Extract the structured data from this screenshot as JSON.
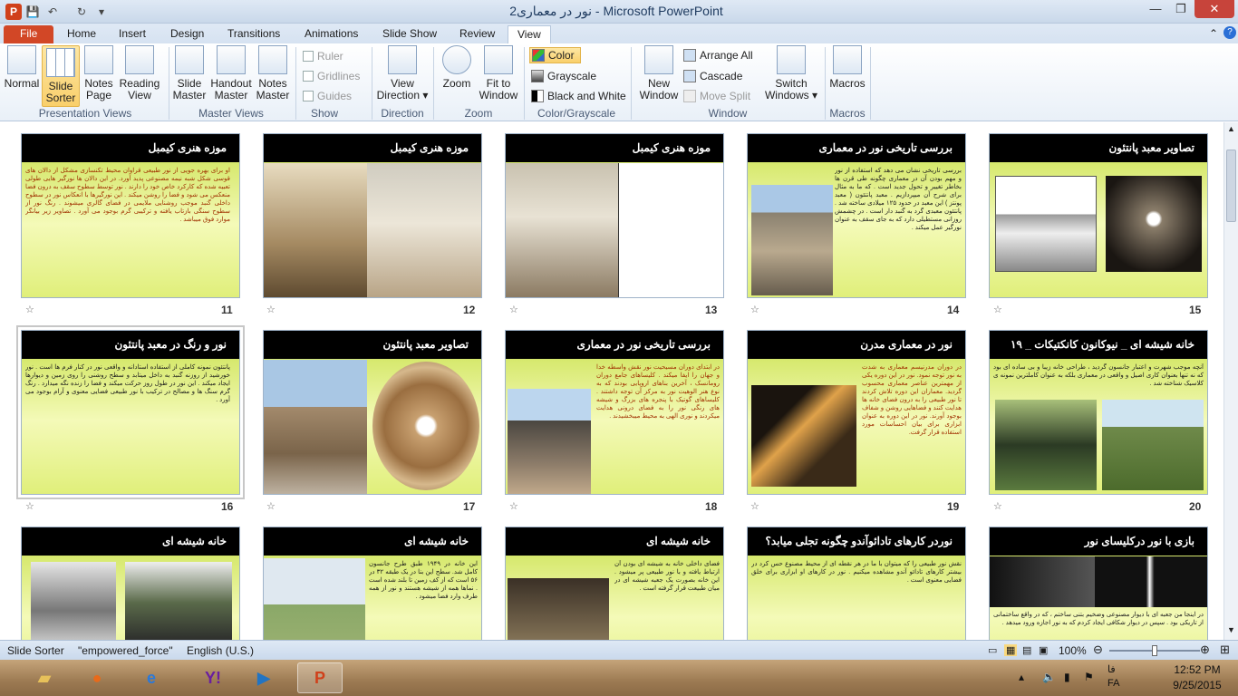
{
  "window": {
    "title": "نور در معماری2 - Microsoft PowerPoint",
    "minimize": "—",
    "maximize": "❐",
    "close": "✕"
  },
  "qat": {
    "save": "💾",
    "undo": "↶",
    "redo": "↻",
    "customize": "▾",
    "logo": "P"
  },
  "tabs": [
    "File",
    "Home",
    "Insert",
    "Design",
    "Transitions",
    "Animations",
    "Slide Show",
    "Review",
    "View"
  ],
  "active_tab": "View",
  "ribbon": {
    "presentation_views": {
      "label": "Presentation Views",
      "normal": "Normal",
      "slide_sorter": "Slide\nSorter",
      "notes_page": "Notes\nPage",
      "reading_view": "Reading\nView"
    },
    "master_views": {
      "label": "Master Views",
      "slide_master": "Slide\nMaster",
      "handout_master": "Handout\nMaster",
      "notes_master": "Notes\nMaster"
    },
    "show": {
      "label": "Show",
      "ruler": "Ruler",
      "gridlines": "Gridlines",
      "guides": "Guides"
    },
    "direction": {
      "label": "Direction",
      "view_direction": "View\nDirection ▾"
    },
    "zoom": {
      "label": "Zoom",
      "zoom": "Zoom",
      "fit_to_window": "Fit to\nWindow"
    },
    "color": {
      "label": "Color/Grayscale",
      "color": "Color",
      "grayscale": "Grayscale",
      "black_white": "Black and White"
    },
    "window": {
      "label": "Window",
      "new_window": "New\nWindow",
      "arrange_all": "Arrange All",
      "cascade": "Cascade",
      "move_split": "Move Split",
      "switch_windows": "Switch\nWindows ▾"
    },
    "macros": {
      "label": "Macros",
      "macros": "Macros"
    }
  },
  "slides_row1": [
    {
      "num": "15",
      "title": "تصاویر معبد پانتئون"
    },
    {
      "num": "14",
      "title": "بررسی تاریخی نور در معماری",
      "text": "بررسی تاریخی نشان می دهد که استفاده از نور و مهم بودن آن در معماری چگونه طی قرن ها بخاطر تغییر و تحول جدید است . که ما به مثال برای شرح آن میپردازیم . معبد پانتئون ( معبد پونتز ) این معبد در حدود ۱۲۵ میلادی ساخته شد . پانتئون معبدی گرد به گنبد دار است . در چشمش روزانی مستطیلی دارد که به جای سقف به عنوان نورگیر عمل میکند ."
    },
    {
      "num": "13",
      "title": "موزه هنری کیمبل"
    },
    {
      "num": "12",
      "title": "موزه هنری کیمبل"
    },
    {
      "num": "11",
      "title": "موزه هنری کیمبل",
      "text": "او برای بهره جویی از نور طبیعی قراوان محیط تکنسازی مشکل از دالان های قوسی شکل شبه نیمه مصنوعی پدید آورد. در این دالان ها نورگیر هایی طولی تعبیه شده که کارکرد خاص خود را دارند . نور توسط سطوح سقف به درون فضا منعکس می شود و فضا را روشن میکند . این نورگیرها با انعکاس نور در سطوح داخلی گنبد موجب روشنایی ملایمی در فضای گالری میشوند . رنگ نور از سطوح سنگی بازتاب یافته و ترکیبی گرم بوجود می آورد . تصاویر زیر بیانگر موارد فوق میباشد ."
    }
  ],
  "slides_row2": [
    {
      "num": "20",
      "title": "خانه شیشه ای _ نیوکانون کانکتیکات _ ۱۹",
      "text": "آنچه موجب شهرت و اعتبار جانسون گردید ، طراحی خانه زیبا و بی ساده ای بود که نه تنها بعنوان کاری اصیل و واقعی در معماری بلکه به عنوان کاملترین نمونه ی کلاسیک شناخته شد ."
    },
    {
      "num": "19",
      "title": "نور در معماری مدرن",
      "text": "در دوران مدرنیسم معماری به شدت به نور توجه نمود. نور در این دوره یکی از مهمترین عناصر معماری محسوب گردید. معماران این دوره تلاش کردند تا نور طبیعی را به درون فضای خانه ها هدایت کنند و فضاهایی روشن و شفاف بوجود آورند. نور در این دوره به عنوان ابزاری برای بیان احساسات مورد استفاده قرار گرفت."
    },
    {
      "num": "18",
      "title": "بررسی تاریخی نور در معماری",
      "text": "در ابتدای دوران مسیحیت نور نقش واسطه خدا و جهان را ایفا میکند . کلیساهای جامع دوران رومانسک ، آخرین بناهای اروپایی بودند که به نوع هنر الوهیت نور به مرکز آن توجه داشتند . کلیساهای گوتیک با پنجره های بزرگ و شیشه های رنگی نور را به فضای درونی هدایت میکردند و نوری الهی به محیط میبخشیدند ."
    },
    {
      "num": "17",
      "title": "تصاویر معبد پانتئون"
    },
    {
      "num": "16",
      "title": "نور و رنگ در معبد پانتئون",
      "text": "پانتئون نمونه کاملی از استفاده استادانه و واقعی نور در کنار فرم ها است . نور خورشید از روزنه گنبد به داخل میتابد و سطح روشنی را روی زمین و دیوارها ایجاد میکند . این نور در طول روز حرکت میکند و فضا را زنده نگه میدارد . رنگ گرم سنگ ها و مصالح در ترکیب با نور طبیعی فضایی معنوی و آرام بوجود می آورد ."
    }
  ],
  "slides_row3": [
    {
      "title": "بازی با نور درکلیسای نور",
      "text": "در اینجا من جعبه ای با دیوار مصنوعی وضخیم بتنی ساختم ، که در واقع ساختمانی از تاریکی بود . سپس در دیوار شکافی ایجاد کردم که به نور اجازه ورود میدهد ."
    },
    {
      "title": "نوردر کارهای تادائوآندو چگونه تجلی میابد؟",
      "text": "نقش نور طبیعی را که میتوان با ما در هر نقطه ای از محیط مصنوع حس کرد در بیشتر کارهای تادائو آندو مشاهده میکنیم . نور در کارهای او ابزاری برای خلق فضایی معنوی است ."
    },
    {
      "title": "خانه شیشه ای",
      "text": "فضای داخلی خانه به شیشه ای بودن آن ارتباط یافته و با نور طبیعی پر میشود . این خانه بصورت یک جعبه شیشه ای در میان طبیعت قرار گرفته است ."
    },
    {
      "title": "خانه شیشه ای",
      "text": "این خانه در ۱۹۴۹ طبق طرح جانسون کامل شد. سطح این بنا در یک طبقه ۳۲ در ۵۶ است که از کف زمین تا بلند شده است . نماها همه از شیشه هستند و نور از همه طرف وارد فضا میشود ."
    },
    {
      "title": "خانه شیشه ای"
    }
  ],
  "status": {
    "view": "Slide Sorter",
    "theme": "\"empowered_force\"",
    "language": "English (U.S.)",
    "zoom": "100%",
    "zoom_level_percent": 100
  },
  "taskbar": {
    "time": "12:52 PM",
    "date": "9/25/2015",
    "lang": "FA",
    "lang2": "فا"
  }
}
